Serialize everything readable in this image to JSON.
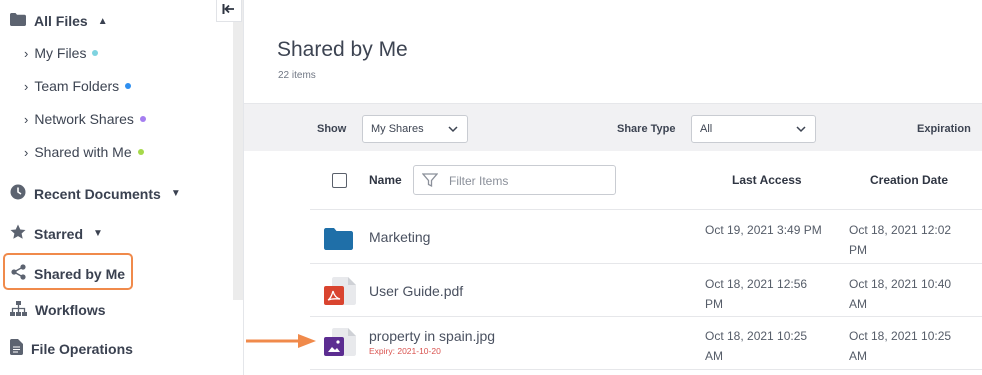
{
  "sidebar": {
    "all_files": "All Files",
    "sub_items": [
      {
        "label": "My Files",
        "dot": "#7fd3e0"
      },
      {
        "label": "Team Folders",
        "dot": "#2f8ff0"
      },
      {
        "label": "Network Shares",
        "dot": "#a57ef0"
      },
      {
        "label": "Shared with Me",
        "dot": "#a6d94a"
      }
    ],
    "recent": "Recent Documents",
    "starred": "Starred",
    "shared_by_me": "Shared by Me",
    "workflows": "Workflows",
    "file_operations": "File Operations"
  },
  "main": {
    "title": "Shared by Me",
    "count": "22 items",
    "filters": {
      "show_label": "Show",
      "show_value": "My Shares",
      "share_type_label": "Share Type",
      "share_type_value": "All",
      "expiration_label": "Expiration"
    },
    "table": {
      "name_header": "Name",
      "filter_placeholder": "Filter Items",
      "last_access_header": "Last Access",
      "creation_date_header": "Creation Date",
      "rows": [
        {
          "name": "Marketing",
          "icon": "folder-icon",
          "last_access": "Oct 19, 2021 3:49 PM",
          "creation": "Oct 18, 2021 12:02 PM"
        },
        {
          "name": "User Guide.pdf",
          "icon": "pdf-icon",
          "last_access": "Oct 18, 2021 12:56 PM",
          "creation": "Oct 18, 2021 10:40 AM"
        },
        {
          "name": "property in spain.jpg",
          "icon": "image-icon",
          "expiry": "Expiry: 2021-10-20",
          "last_access": "Oct 18, 2021 10:25 AM",
          "creation": "Oct 18, 2021 10:25 AM"
        }
      ]
    }
  },
  "colors": {
    "accent_orange": "#f08a4b",
    "folder_blue": "#1f6fa8",
    "pdf_red": "#d9442f",
    "image_purple": "#5c2d91"
  }
}
